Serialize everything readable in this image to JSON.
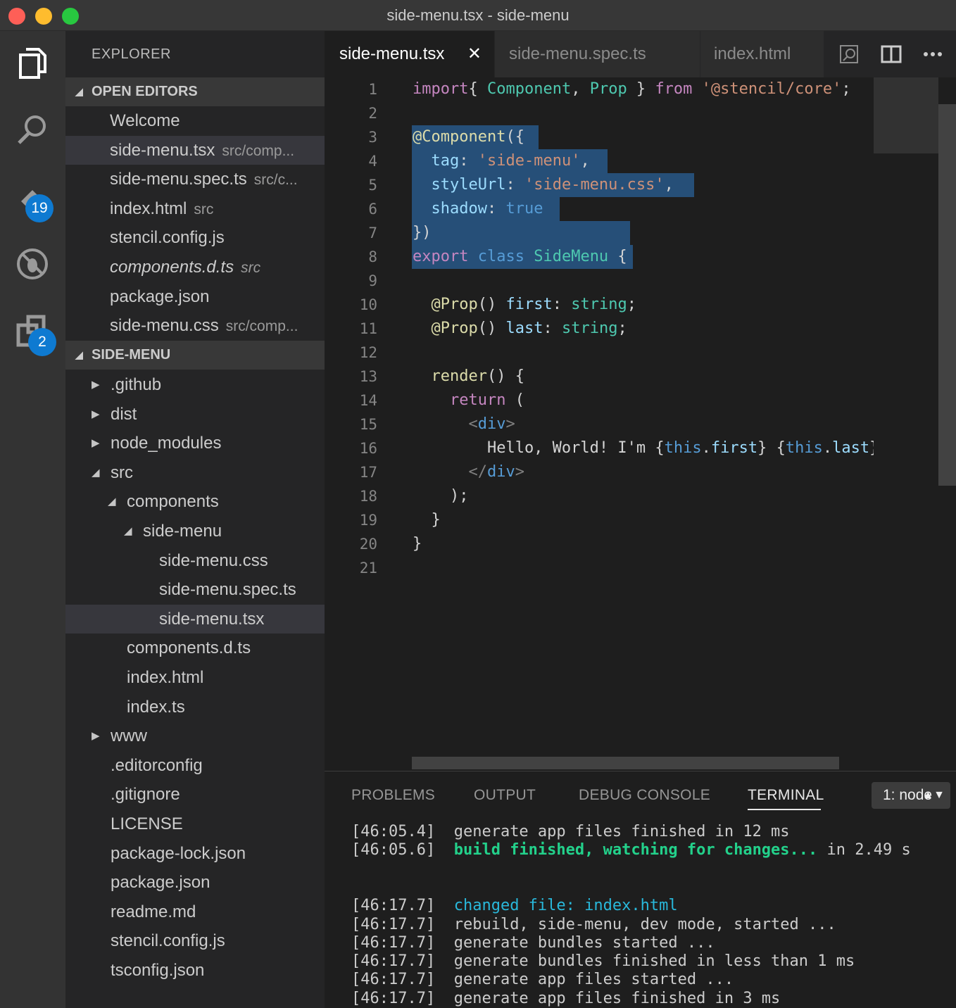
{
  "window": {
    "title": "side-menu.tsx - side-menu"
  },
  "activity_bar": {
    "items": [
      {
        "icon": "files-icon"
      },
      {
        "icon": "search-icon"
      },
      {
        "icon": "source-control-icon",
        "badge": "19"
      },
      {
        "icon": "no-debug-icon"
      },
      {
        "icon": "extensions-icon",
        "badge": "2"
      }
    ]
  },
  "sidebar": {
    "title": "EXPLORER",
    "open_editors": {
      "label": "OPEN EDITORS",
      "items": [
        {
          "name": "Welcome",
          "desc": ""
        },
        {
          "name": "side-menu.tsx",
          "desc": "src/comp..."
        },
        {
          "name": "side-menu.spec.ts",
          "desc": "src/c..."
        },
        {
          "name": "index.html",
          "desc": "src"
        },
        {
          "name": "stencil.config.js",
          "desc": ""
        },
        {
          "name": "components.d.ts",
          "desc": "src"
        },
        {
          "name": "package.json",
          "desc": ""
        },
        {
          "name": "side-menu.css",
          "desc": "src/comp..."
        }
      ]
    },
    "project": {
      "label": "SIDE-MENU",
      "items": [
        {
          "name": ".github",
          "arrow": "▶"
        },
        {
          "name": "dist",
          "arrow": "▶"
        },
        {
          "name": "node_modules",
          "arrow": "▶"
        },
        {
          "name": "src",
          "arrow": "◢"
        },
        {
          "name": "components",
          "arrow": "◢"
        },
        {
          "name": "side-menu",
          "arrow": "◢"
        },
        {
          "name": "side-menu.css",
          "arrow": ""
        },
        {
          "name": "side-menu.spec.ts",
          "arrow": ""
        },
        {
          "name": "side-menu.tsx",
          "arrow": ""
        },
        {
          "name": "components.d.ts",
          "arrow": ""
        },
        {
          "name": "index.html",
          "arrow": ""
        },
        {
          "name": "index.ts",
          "arrow": ""
        },
        {
          "name": "www",
          "arrow": "▶"
        },
        {
          "name": ".editorconfig",
          "arrow": ""
        },
        {
          "name": ".gitignore",
          "arrow": ""
        },
        {
          "name": "LICENSE",
          "arrow": ""
        },
        {
          "name": "package-lock.json",
          "arrow": ""
        },
        {
          "name": "package.json",
          "arrow": ""
        },
        {
          "name": "readme.md",
          "arrow": ""
        },
        {
          "name": "stencil.config.js",
          "arrow": ""
        },
        {
          "name": "tsconfig.json",
          "arrow": ""
        }
      ]
    }
  },
  "tabs": [
    {
      "label": "side-menu.tsx",
      "close": "✕"
    },
    {
      "label": "side-menu.spec.ts"
    },
    {
      "label": "index.html"
    }
  ],
  "editor": {
    "line_numbers": [
      "1",
      "2",
      "3",
      "4",
      "5",
      "6",
      "7",
      "8",
      "9",
      "10",
      "11",
      "12",
      "13",
      "14",
      "15",
      "16",
      "17",
      "18",
      "19",
      "20",
      "21"
    ],
    "lines": [
      [
        [
          "kw",
          "import"
        ],
        [
          "",
          "{ "
        ],
        [
          "ty",
          "Component"
        ],
        [
          "",
          ", "
        ],
        [
          "ty",
          "Prop"
        ],
        [
          "",
          " } "
        ],
        [
          "kw",
          "from"
        ],
        [
          "",
          " "
        ],
        [
          "st",
          "'@stencil/core'"
        ],
        [
          "",
          ";"
        ]
      ],
      [],
      [
        [
          "fn",
          "@Component"
        ],
        [
          "",
          "({"
        ]
      ],
      [
        [
          "",
          "  "
        ],
        [
          "pr",
          "tag"
        ],
        [
          "",
          ": "
        ],
        [
          "st",
          "'side-menu'"
        ],
        [
          "",
          ","
        ]
      ],
      [
        [
          "",
          "  "
        ],
        [
          "pr",
          "styleUrl"
        ],
        [
          "",
          ": "
        ],
        [
          "st",
          "'side-menu.css'"
        ],
        [
          "",
          ","
        ]
      ],
      [
        [
          "",
          "  "
        ],
        [
          "pr",
          "shadow"
        ],
        [
          "",
          ": "
        ],
        [
          "k2",
          "true"
        ]
      ],
      [
        [
          "",
          "})"
        ]
      ],
      [
        [
          "kw",
          "export"
        ],
        [
          "",
          " "
        ],
        [
          "k2",
          "class"
        ],
        [
          "",
          " "
        ],
        [
          "ty",
          "SideMenu"
        ],
        [
          "",
          " {"
        ]
      ],
      [],
      [
        [
          "",
          "  "
        ],
        [
          "fn",
          "@Prop"
        ],
        [
          "",
          "() "
        ],
        [
          "pr",
          "first"
        ],
        [
          "",
          ": "
        ],
        [
          "ty",
          "string"
        ],
        [
          "",
          ";"
        ]
      ],
      [
        [
          "",
          "  "
        ],
        [
          "fn",
          "@Prop"
        ],
        [
          "",
          "() "
        ],
        [
          "pr",
          "last"
        ],
        [
          "",
          ": "
        ],
        [
          "ty",
          "string"
        ],
        [
          "",
          ";"
        ]
      ],
      [],
      [
        [
          "",
          "  "
        ],
        [
          "fn",
          "render"
        ],
        [
          "",
          "() {"
        ]
      ],
      [
        [
          "",
          "    "
        ],
        [
          "kw",
          "return"
        ],
        [
          "",
          " ("
        ]
      ],
      [
        [
          "",
          "      "
        ],
        [
          "pu",
          "<"
        ],
        [
          "tg",
          "div"
        ],
        [
          "pu",
          ">"
        ]
      ],
      [
        [
          "",
          "        Hello, World! I'm {"
        ],
        [
          "k2",
          "this"
        ],
        [
          "",
          "."
        ],
        [
          "pr",
          "first"
        ],
        [
          "",
          "} {"
        ],
        [
          "k2",
          "this"
        ],
        [
          "",
          "."
        ],
        [
          "pr",
          "last"
        ],
        [
          "",
          "}"
        ]
      ],
      [
        [
          "",
          "      "
        ],
        [
          "pu",
          "</"
        ],
        [
          "tg",
          "div"
        ],
        [
          "pu",
          ">"
        ]
      ],
      [
        [
          "",
          "    );"
        ]
      ],
      [
        [
          "",
          "  }"
        ]
      ],
      [
        [
          "",
          "}"
        ]
      ],
      []
    ]
  },
  "panel": {
    "tabs": [
      "PROBLEMS",
      "OUTPUT",
      "DEBUG CONSOLE",
      "TERMINAL"
    ],
    "active_tab": "TERMINAL",
    "terminal_select": "1: node",
    "terminal": [
      {
        "time": "[46:05.4]",
        "parts": [
          [
            "",
            "generate app files finished in 12 ms"
          ]
        ]
      },
      {
        "time": "[46:05.6]",
        "parts": [
          [
            "green",
            "build finished, watching for changes..."
          ],
          [
            "",
            " in 2.49 s"
          ]
        ]
      },
      {
        "time": "",
        "parts": []
      },
      {
        "time": "",
        "parts": []
      },
      {
        "time": "[46:17.7]",
        "parts": [
          [
            "cyan",
            "changed file: index.html"
          ]
        ]
      },
      {
        "time": "[46:17.7]",
        "parts": [
          [
            "",
            "rebuild, side-menu, dev mode, started ..."
          ]
        ]
      },
      {
        "time": "[46:17.7]",
        "parts": [
          [
            "",
            "generate bundles started ..."
          ]
        ]
      },
      {
        "time": "[46:17.7]",
        "parts": [
          [
            "",
            "generate bundles finished in less than 1 ms"
          ]
        ]
      },
      {
        "time": "[46:17.7]",
        "parts": [
          [
            "",
            "generate app files started ..."
          ]
        ]
      },
      {
        "time": "[46:17.7]",
        "parts": [
          [
            "",
            "generate app files finished in 3 ms"
          ]
        ]
      }
    ]
  },
  "colors": {
    "traffic_close": "#fe5f57",
    "traffic_min": "#febc2e",
    "traffic_max": "#28c840",
    "badge": "#0e7ad1",
    "selection": "#264f78"
  }
}
